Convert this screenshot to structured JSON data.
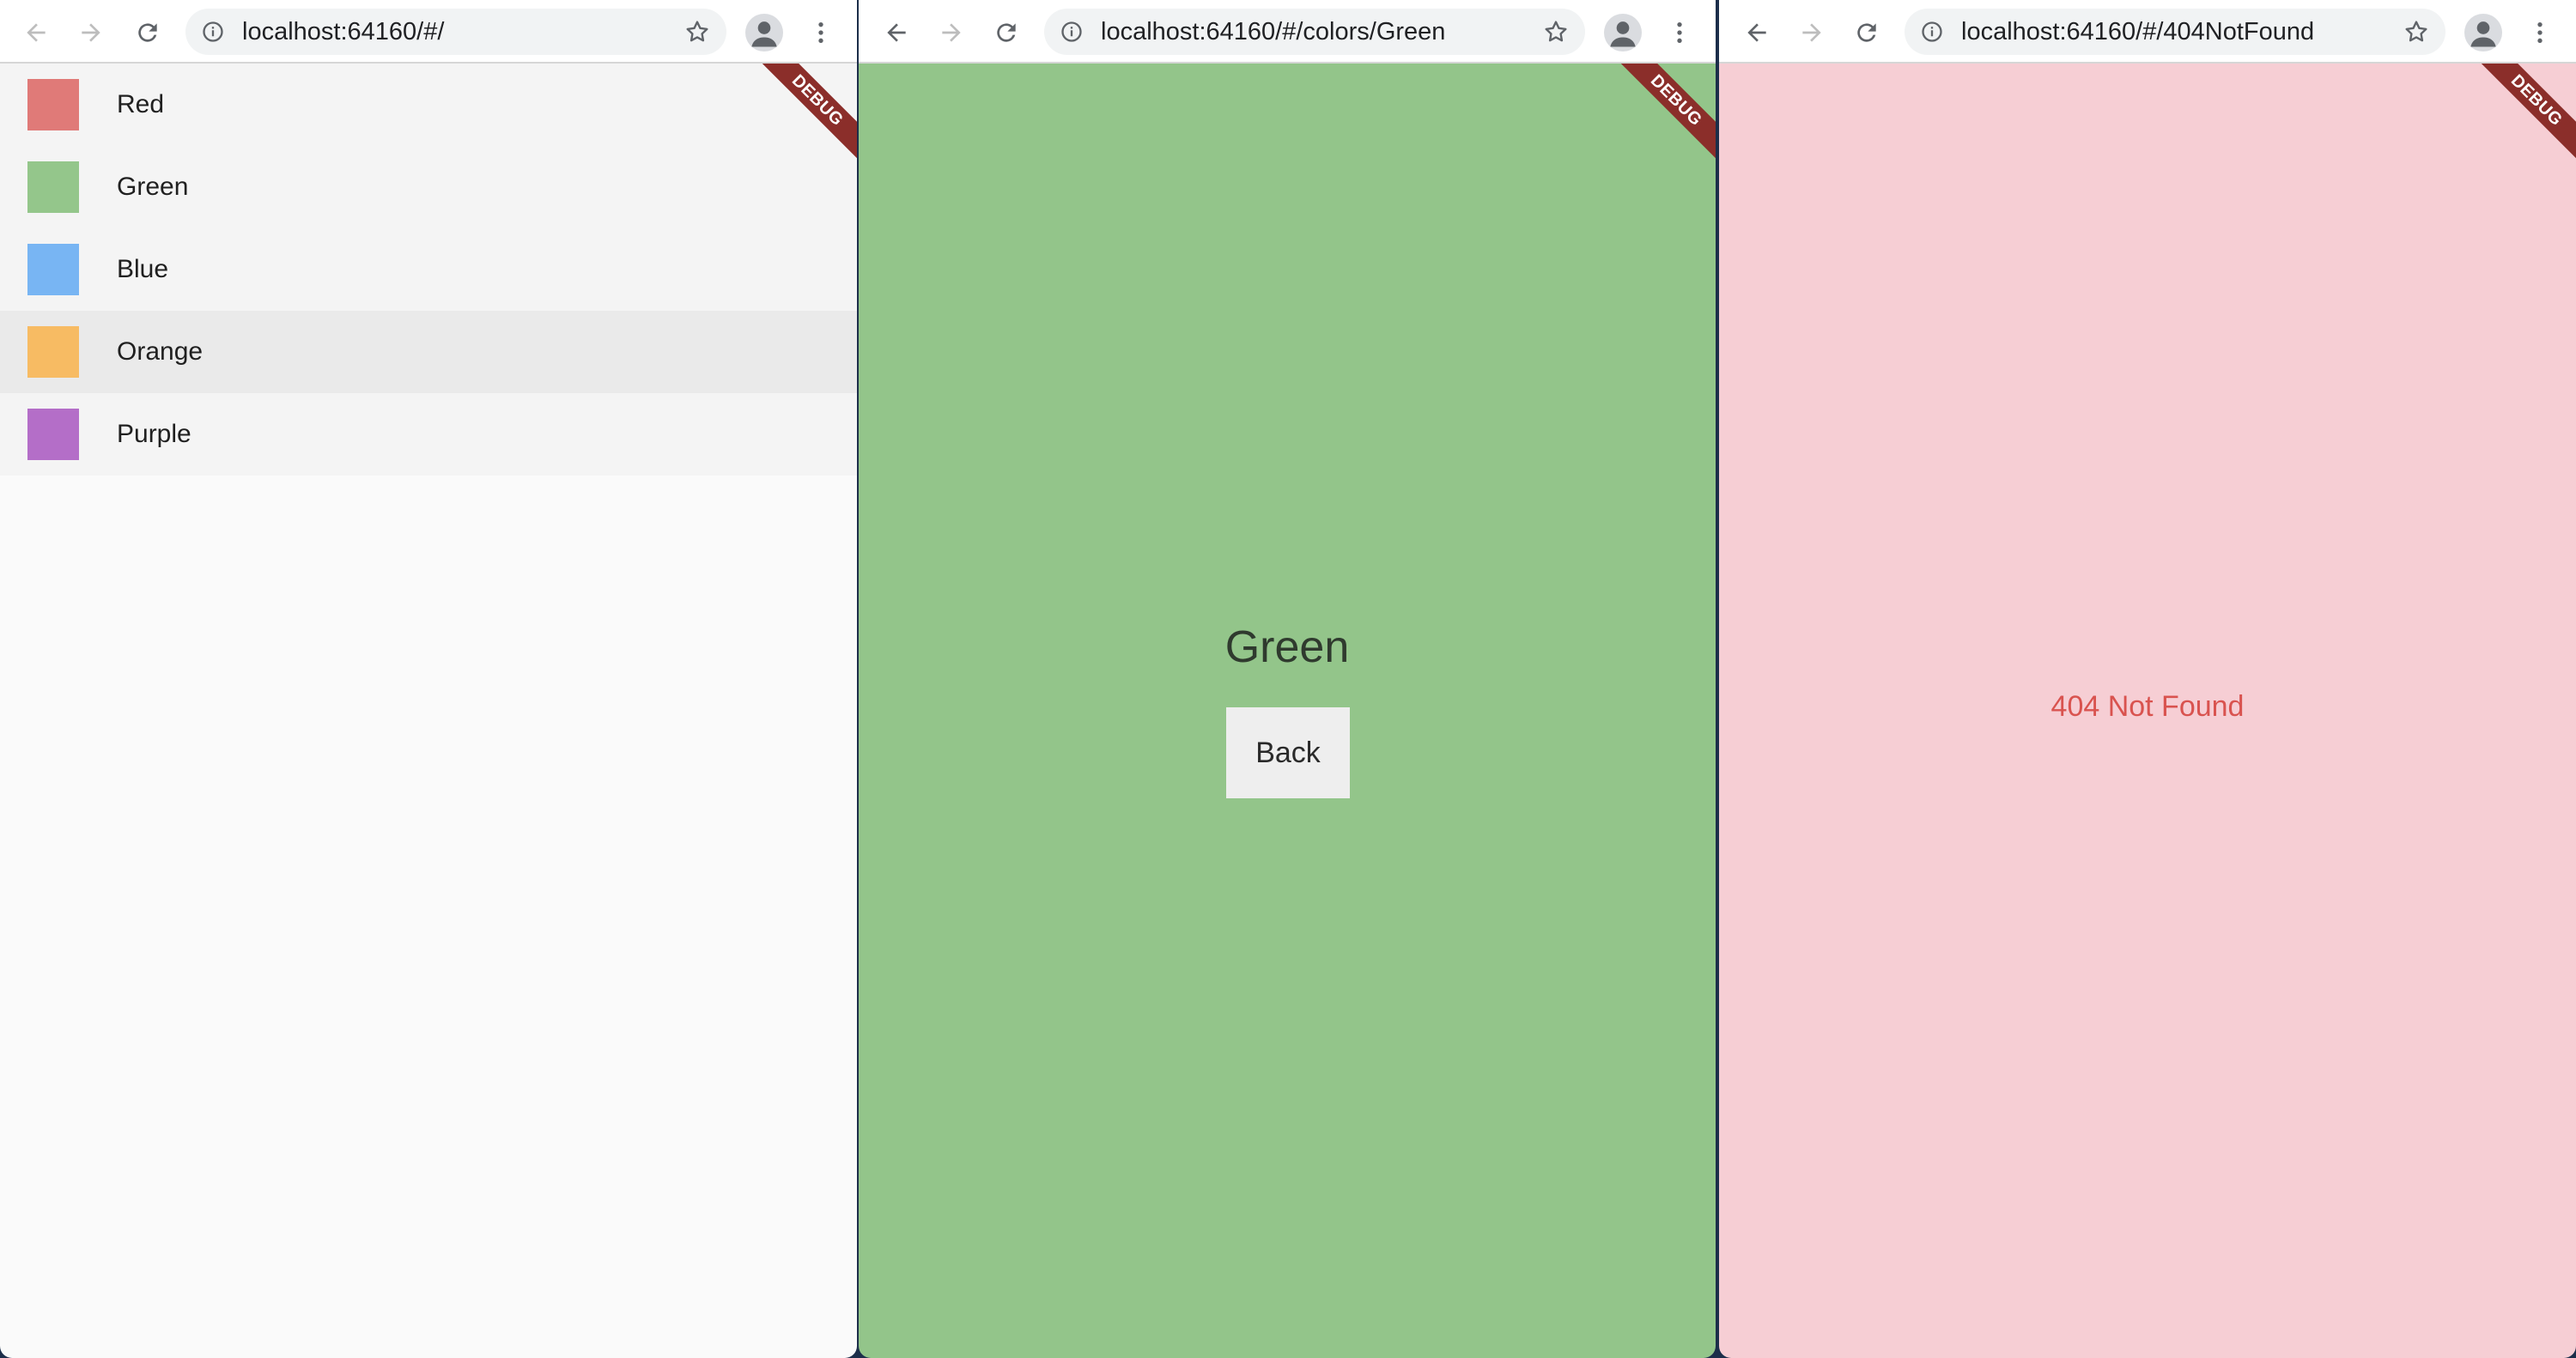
{
  "windows": [
    {
      "url": "localhost:64160/#/",
      "debug_label": "DEBUG",
      "colors": [
        {
          "name": "Red",
          "hex": "#e07a78"
        },
        {
          "name": "Green",
          "hex": "#94c68b"
        },
        {
          "name": "Blue",
          "hex": "#78b5f3"
        },
        {
          "name": "Orange",
          "hex": "#f7bb63"
        },
        {
          "name": "Purple",
          "hex": "#b46ec8"
        }
      ],
      "hovered_item": "Orange"
    },
    {
      "url": "localhost:64160/#/colors/Green",
      "debug_label": "DEBUG",
      "title": "Green",
      "back_label": "Back",
      "background": "#93c58a"
    },
    {
      "url": "localhost:64160/#/404NotFound",
      "debug_label": "DEBUG",
      "message": "404 Not Found",
      "background": "#f6ced4"
    }
  ]
}
